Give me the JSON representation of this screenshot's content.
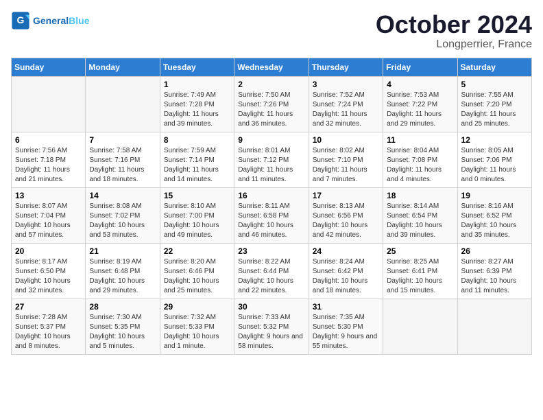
{
  "header": {
    "logo_text_general": "General",
    "logo_text_blue": "Blue",
    "month_title": "October 2024",
    "location": "Longperrier, France"
  },
  "weekdays": [
    "Sunday",
    "Monday",
    "Tuesday",
    "Wednesday",
    "Thursday",
    "Friday",
    "Saturday"
  ],
  "weeks": [
    [
      {
        "day": "",
        "sunrise": "",
        "sunset": "",
        "daylight": ""
      },
      {
        "day": "",
        "sunrise": "",
        "sunset": "",
        "daylight": ""
      },
      {
        "day": "1",
        "sunrise": "Sunrise: 7:49 AM",
        "sunset": "Sunset: 7:28 PM",
        "daylight": "Daylight: 11 hours and 39 minutes."
      },
      {
        "day": "2",
        "sunrise": "Sunrise: 7:50 AM",
        "sunset": "Sunset: 7:26 PM",
        "daylight": "Daylight: 11 hours and 36 minutes."
      },
      {
        "day": "3",
        "sunrise": "Sunrise: 7:52 AM",
        "sunset": "Sunset: 7:24 PM",
        "daylight": "Daylight: 11 hours and 32 minutes."
      },
      {
        "day": "4",
        "sunrise": "Sunrise: 7:53 AM",
        "sunset": "Sunset: 7:22 PM",
        "daylight": "Daylight: 11 hours and 29 minutes."
      },
      {
        "day": "5",
        "sunrise": "Sunrise: 7:55 AM",
        "sunset": "Sunset: 7:20 PM",
        "daylight": "Daylight: 11 hours and 25 minutes."
      }
    ],
    [
      {
        "day": "6",
        "sunrise": "Sunrise: 7:56 AM",
        "sunset": "Sunset: 7:18 PM",
        "daylight": "Daylight: 11 hours and 21 minutes."
      },
      {
        "day": "7",
        "sunrise": "Sunrise: 7:58 AM",
        "sunset": "Sunset: 7:16 PM",
        "daylight": "Daylight: 11 hours and 18 minutes."
      },
      {
        "day": "8",
        "sunrise": "Sunrise: 7:59 AM",
        "sunset": "Sunset: 7:14 PM",
        "daylight": "Daylight: 11 hours and 14 minutes."
      },
      {
        "day": "9",
        "sunrise": "Sunrise: 8:01 AM",
        "sunset": "Sunset: 7:12 PM",
        "daylight": "Daylight: 11 hours and 11 minutes."
      },
      {
        "day": "10",
        "sunrise": "Sunrise: 8:02 AM",
        "sunset": "Sunset: 7:10 PM",
        "daylight": "Daylight: 11 hours and 7 minutes."
      },
      {
        "day": "11",
        "sunrise": "Sunrise: 8:04 AM",
        "sunset": "Sunset: 7:08 PM",
        "daylight": "Daylight: 11 hours and 4 minutes."
      },
      {
        "day": "12",
        "sunrise": "Sunrise: 8:05 AM",
        "sunset": "Sunset: 7:06 PM",
        "daylight": "Daylight: 11 hours and 0 minutes."
      }
    ],
    [
      {
        "day": "13",
        "sunrise": "Sunrise: 8:07 AM",
        "sunset": "Sunset: 7:04 PM",
        "daylight": "Daylight: 10 hours and 57 minutes."
      },
      {
        "day": "14",
        "sunrise": "Sunrise: 8:08 AM",
        "sunset": "Sunset: 7:02 PM",
        "daylight": "Daylight: 10 hours and 53 minutes."
      },
      {
        "day": "15",
        "sunrise": "Sunrise: 8:10 AM",
        "sunset": "Sunset: 7:00 PM",
        "daylight": "Daylight: 10 hours and 49 minutes."
      },
      {
        "day": "16",
        "sunrise": "Sunrise: 8:11 AM",
        "sunset": "Sunset: 6:58 PM",
        "daylight": "Daylight: 10 hours and 46 minutes."
      },
      {
        "day": "17",
        "sunrise": "Sunrise: 8:13 AM",
        "sunset": "Sunset: 6:56 PM",
        "daylight": "Daylight: 10 hours and 42 minutes."
      },
      {
        "day": "18",
        "sunrise": "Sunrise: 8:14 AM",
        "sunset": "Sunset: 6:54 PM",
        "daylight": "Daylight: 10 hours and 39 minutes."
      },
      {
        "day": "19",
        "sunrise": "Sunrise: 8:16 AM",
        "sunset": "Sunset: 6:52 PM",
        "daylight": "Daylight: 10 hours and 35 minutes."
      }
    ],
    [
      {
        "day": "20",
        "sunrise": "Sunrise: 8:17 AM",
        "sunset": "Sunset: 6:50 PM",
        "daylight": "Daylight: 10 hours and 32 minutes."
      },
      {
        "day": "21",
        "sunrise": "Sunrise: 8:19 AM",
        "sunset": "Sunset: 6:48 PM",
        "daylight": "Daylight: 10 hours and 29 minutes."
      },
      {
        "day": "22",
        "sunrise": "Sunrise: 8:20 AM",
        "sunset": "Sunset: 6:46 PM",
        "daylight": "Daylight: 10 hours and 25 minutes."
      },
      {
        "day": "23",
        "sunrise": "Sunrise: 8:22 AM",
        "sunset": "Sunset: 6:44 PM",
        "daylight": "Daylight: 10 hours and 22 minutes."
      },
      {
        "day": "24",
        "sunrise": "Sunrise: 8:24 AM",
        "sunset": "Sunset: 6:42 PM",
        "daylight": "Daylight: 10 hours and 18 minutes."
      },
      {
        "day": "25",
        "sunrise": "Sunrise: 8:25 AM",
        "sunset": "Sunset: 6:41 PM",
        "daylight": "Daylight: 10 hours and 15 minutes."
      },
      {
        "day": "26",
        "sunrise": "Sunrise: 8:27 AM",
        "sunset": "Sunset: 6:39 PM",
        "daylight": "Daylight: 10 hours and 11 minutes."
      }
    ],
    [
      {
        "day": "27",
        "sunrise": "Sunrise: 7:28 AM",
        "sunset": "Sunset: 5:37 PM",
        "daylight": "Daylight: 10 hours and 8 minutes."
      },
      {
        "day": "28",
        "sunrise": "Sunrise: 7:30 AM",
        "sunset": "Sunset: 5:35 PM",
        "daylight": "Daylight: 10 hours and 5 minutes."
      },
      {
        "day": "29",
        "sunrise": "Sunrise: 7:32 AM",
        "sunset": "Sunset: 5:33 PM",
        "daylight": "Daylight: 10 hours and 1 minute."
      },
      {
        "day": "30",
        "sunrise": "Sunrise: 7:33 AM",
        "sunset": "Sunset: 5:32 PM",
        "daylight": "Daylight: 9 hours and 58 minutes."
      },
      {
        "day": "31",
        "sunrise": "Sunrise: 7:35 AM",
        "sunset": "Sunset: 5:30 PM",
        "daylight": "Daylight: 9 hours and 55 minutes."
      },
      {
        "day": "",
        "sunrise": "",
        "sunset": "",
        "daylight": ""
      },
      {
        "day": "",
        "sunrise": "",
        "sunset": "",
        "daylight": ""
      }
    ]
  ]
}
